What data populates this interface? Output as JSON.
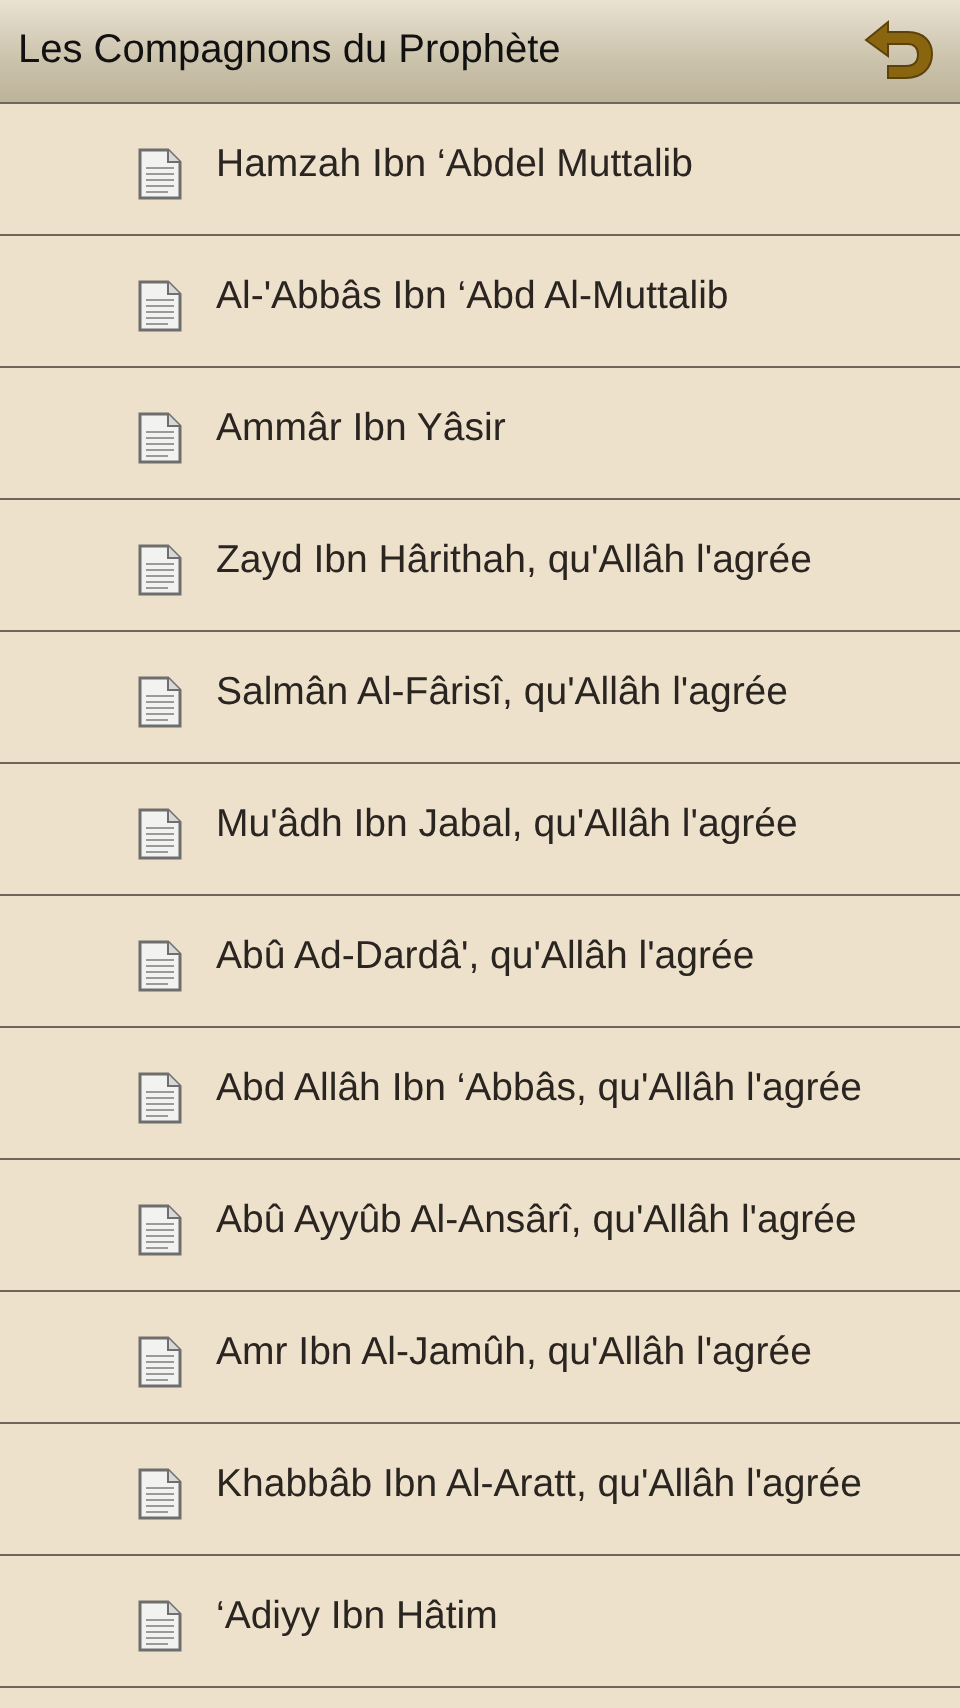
{
  "header": {
    "title": "Les Compagnons du Prophète"
  },
  "items": [
    {
      "label": "Hamzah Ibn ‘Abdel Muttalib"
    },
    {
      "label": "Al-'Abbâs Ibn ‘Abd Al-Muttalib"
    },
    {
      "label": "Ammâr Ibn Yâsir"
    },
    {
      "label": "Zayd Ibn Hârithah, qu'Allâh l'agrée"
    },
    {
      "label": "Salmân Al-Fârisî, qu'Allâh l'agrée"
    },
    {
      "label": "Mu'âdh Ibn Jabal, qu'Allâh l'agrée"
    },
    {
      "label": "Abû Ad-Dardâ', qu'Allâh l'agrée"
    },
    {
      "label": "Abd Allâh Ibn ‘Abbâs, qu'Allâh l'agrée"
    },
    {
      "label": "Abû Ayyûb Al-Ansârî, qu'Allâh l'agrée"
    },
    {
      "label": "Amr Ibn Al-Jamûh, qu'Allâh l'agrée"
    },
    {
      "label": "Khabbâb Ibn Al-Aratt, qu'Allâh l'agrée"
    },
    {
      "label": "‘Adiyy Ibn Hâtim"
    }
  ]
}
